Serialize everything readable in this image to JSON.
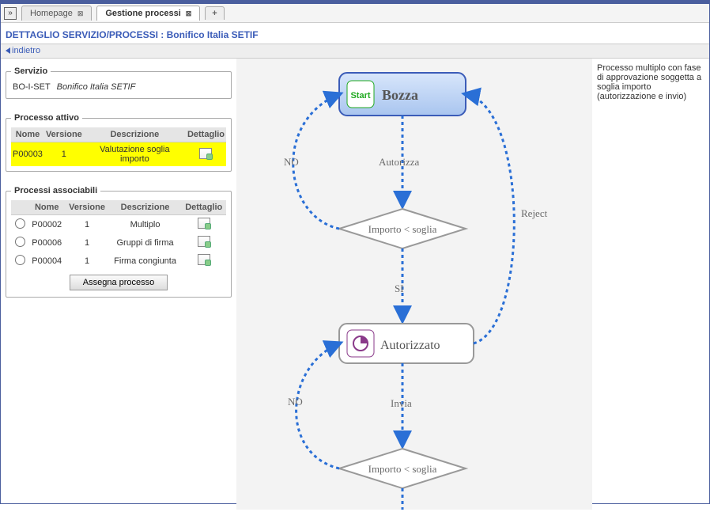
{
  "tabs": {
    "homepage": "Homepage",
    "active": "Gestione processi",
    "add": "+"
  },
  "page_title": "DETTAGLIO SERVIZIO/PROCESSI : Bonifico Italia SETIF",
  "back_label": "indietro",
  "servizio": {
    "legend": "Servizio",
    "code": "BO-I-SET",
    "desc": "Bonifico Italia SETIF"
  },
  "active_process": {
    "legend": "Processo attivo",
    "cols": {
      "nome": "Nome",
      "versione": "Versione",
      "descrizione": "Descrizione",
      "dettaglio": "Dettaglio"
    },
    "row": {
      "nome": "P00003",
      "versione": "1",
      "descrizione": "Valutazione soglia importo"
    }
  },
  "assoc": {
    "legend": "Processi associabili",
    "cols": {
      "nome": "Nome",
      "versione": "Versione",
      "descrizione": "Descrizione",
      "dettaglio": "Dettaglio"
    },
    "rows": [
      {
        "nome": "P00002",
        "versione": "1",
        "descrizione": "Multiplo"
      },
      {
        "nome": "P00006",
        "versione": "1",
        "descrizione": "Gruppi di firma"
      },
      {
        "nome": "P00004",
        "versione": "1",
        "descrizione": "Firma congiunta"
      }
    ],
    "assign_btn": "Assegna processo"
  },
  "right_text": "Processo multiplo con fase di approvazione soggetta a soglia importo (autorizzazione e invio)",
  "diagram": {
    "bozza": "Bozza",
    "autorizzato": "Autorizzato",
    "cond": "Importo < soglia",
    "autorizza": "Autorizza",
    "invia": "Invia",
    "reject": "Reject",
    "no": "NO",
    "si": "SI",
    "start": "Start"
  }
}
